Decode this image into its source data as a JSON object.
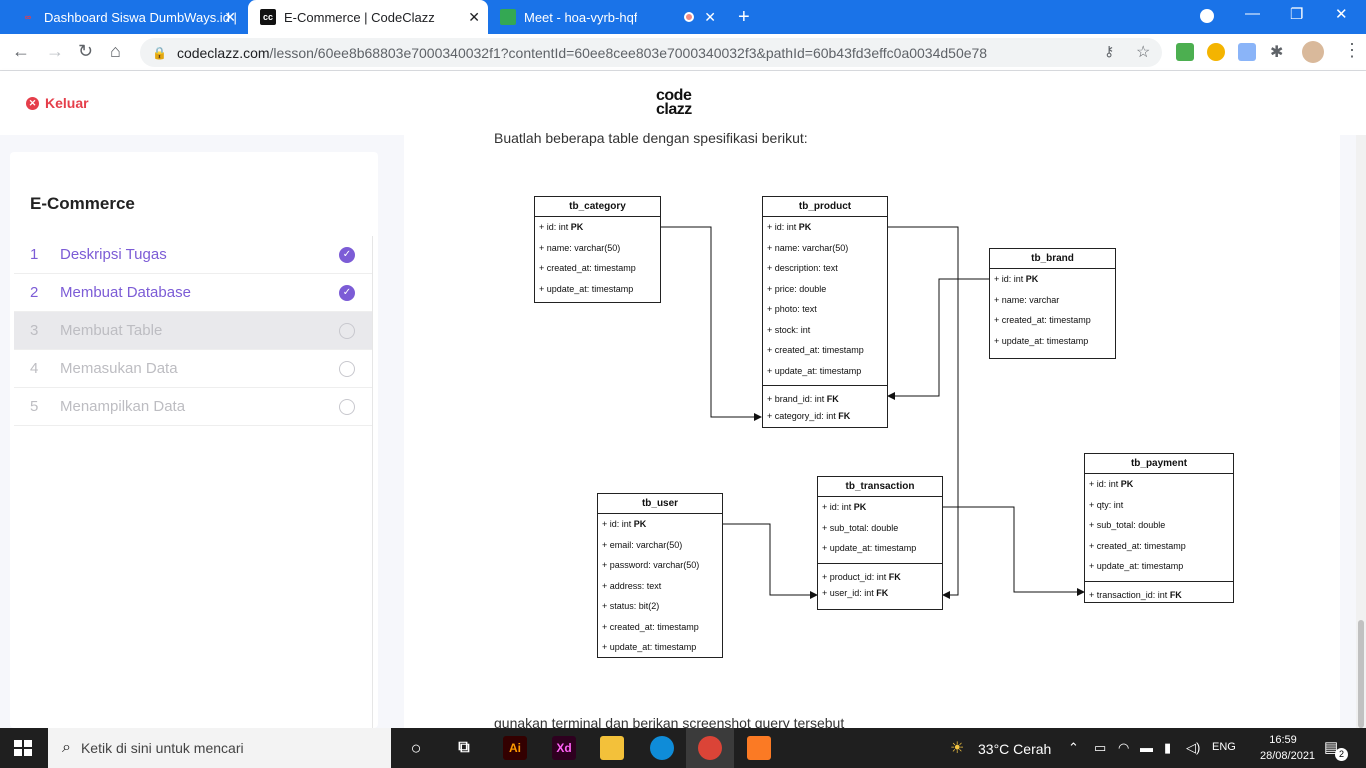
{
  "browser": {
    "tabs": [
      {
        "title": "Dashboard Siswa DumbWays.id |",
        "active": false,
        "favicon": "dumbways-icon"
      },
      {
        "title": "E-Commerce | CodeClazz",
        "active": true,
        "favicon": "codeclazz-icon"
      },
      {
        "title": "Meet - hoa-vyrb-hqf",
        "active": false,
        "favicon": "meet-icon"
      }
    ],
    "url_host": "codeclazz.com",
    "url_path": "/lesson/60ee8b68803e7000340032f1?contentId=60ee8cee803e7000340032f3&pathId=60b43fd3effc0a0034d50e78"
  },
  "header": {
    "exit_label": "Keluar",
    "logo_top": "code",
    "logo_bottom": "clazz"
  },
  "sidebar": {
    "title": "E-Commerce",
    "steps": [
      {
        "num": "1",
        "label": "Deskripsi Tugas",
        "state": "done"
      },
      {
        "num": "2",
        "label": "Membuat Database",
        "state": "done"
      },
      {
        "num": "3",
        "label": "Membuat Table",
        "state": "current"
      },
      {
        "num": "4",
        "label": "Memasukan Data",
        "state": "todo"
      },
      {
        "num": "5",
        "label": "Menampilkan Data",
        "state": "todo"
      }
    ]
  },
  "main": {
    "intro": "Buatlah beberapa table dengan spesifikasi berikut:",
    "outro": "gunakan terminal dan berikan screenshot query tersebut"
  },
  "diagram": {
    "tables": {
      "category": {
        "name": "tb_category",
        "fields": [
          "+ id: int PK",
          "+ name: varchar(50)",
          "+ created_at: timestamp",
          "+ update_at: timestamp"
        ],
        "fk": []
      },
      "product": {
        "name": "tb_product",
        "fields": [
          "+ id: int PK",
          "+ name: varchar(50)",
          "+ description: text",
          "+ price: double",
          "+ photo: text",
          "+ stock: int",
          "+ created_at: timestamp",
          "+ update_at: timestamp"
        ],
        "fk": [
          "+ brand_id: int FK",
          "+ category_id: int FK"
        ]
      },
      "brand": {
        "name": "tb_brand",
        "fields": [
          "+ id: int PK",
          "+ name: varchar",
          "+ created_at: timestamp",
          "+ update_at: timestamp"
        ],
        "fk": []
      },
      "user": {
        "name": "tb_user",
        "fields": [
          "+ id: int PK",
          "+ email: varchar(50)",
          "+ password: varchar(50)",
          "+ address: text",
          "+ status: bit(2)",
          "+ created_at: timestamp",
          "+ update_at: timestamp"
        ],
        "fk": []
      },
      "transaction": {
        "name": "tb_transaction",
        "fields": [
          "+ id: int PK",
          "+ sub_total: double",
          "+ update_at: timestamp"
        ],
        "fk": [
          "+ product_id: int FK",
          "+ user_id: int FK"
        ]
      },
      "payment": {
        "name": "tb_payment",
        "fields": [
          "+ id: int PK",
          "+ qty: int",
          "+ sub_total: double",
          "+ created_at: timestamp",
          "+ update_at: timestamp"
        ],
        "fk": [
          "+ transaction_id: int FK"
        ]
      }
    }
  },
  "taskbar": {
    "search_placeholder": "Ketik di sini untuk mencari",
    "weather": "33°C  Cerah",
    "lang": "ENG",
    "time": "16:59",
    "date": "28/08/2021",
    "notifications": "2"
  },
  "colors": {
    "accent": "#7c5cd6",
    "exit": "#e53e4a",
    "chrome_blue": "#1a73e8"
  }
}
